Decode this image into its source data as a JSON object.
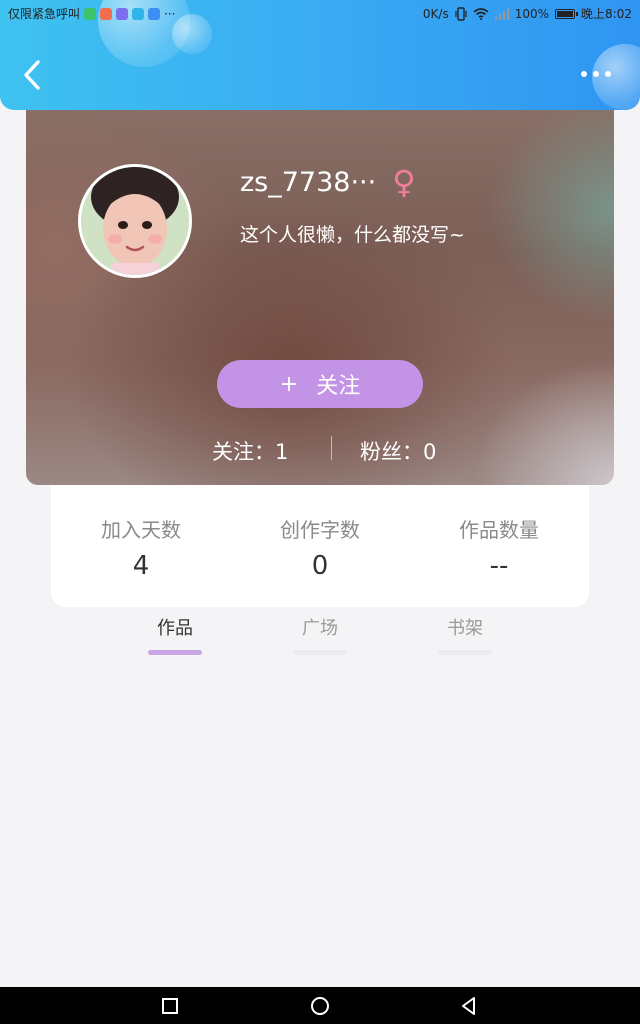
{
  "statusbar": {
    "left_text": "仅限紧急呼叫",
    "app_icons": [
      "#3cc36b",
      "#f26c4f",
      "#7d6ef0",
      "#2fb3e8",
      "#3d8ef5"
    ],
    "overflow": "···",
    "net_speed": "0K/s",
    "battery": "100%",
    "time": "晚上8:02"
  },
  "header": {
    "back_icon": "chevron-left-icon",
    "more_icon": "more-dots-icon"
  },
  "profile": {
    "username": "zs_7738···",
    "gender_symbol": "♀",
    "bio": "这个人很懒，什么都没写~",
    "follow_button": {
      "plus": "+",
      "label": "关注"
    },
    "following": "关注：1",
    "fans": "粉丝：0"
  },
  "stats": [
    {
      "label": "加入天数",
      "value": "4"
    },
    {
      "label": "创作字数",
      "value": "0"
    },
    {
      "label": "作品数量",
      "value": "--"
    }
  ],
  "tabs": [
    {
      "label": "作品",
      "active": true
    },
    {
      "label": "广场",
      "active": false
    },
    {
      "label": "书架",
      "active": false
    }
  ],
  "colors": {
    "header": "#3aaef2",
    "accent": "#c393e6",
    "female": "#f07f9b"
  }
}
